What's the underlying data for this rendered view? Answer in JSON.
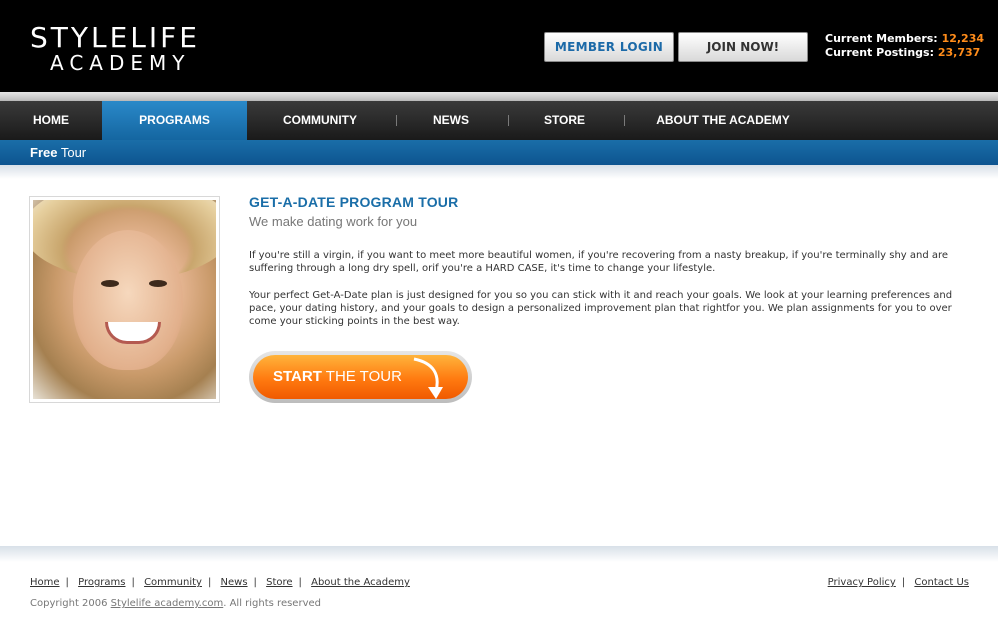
{
  "header": {
    "logo_line1": "STYLELIFE",
    "logo_line2": "ACADEMY",
    "member_login": "MEMBER  LOGIN",
    "join_now": "JOIN NOW!",
    "members_label": "Current Members:",
    "members_value": "12,234",
    "postings_label": "Current Postings:",
    "postings_value": "23,737"
  },
  "nav": {
    "items": [
      {
        "label": "HOME",
        "active": false
      },
      {
        "label": "PROGRAMS",
        "active": true
      },
      {
        "label": "COMMUNITY",
        "active": false
      },
      {
        "label": "NEWS",
        "active": false
      },
      {
        "label": "STORE",
        "active": false
      },
      {
        "label": "ABOUT THE ACADEMY",
        "active": false
      }
    ]
  },
  "subnav": {
    "bold": "Free",
    "rest": " Tour"
  },
  "content": {
    "title": "GET-A-DATE PROGRAM TOUR",
    "subtitle": "We make dating work for you",
    "para1": "If you're still a virgin, if you want to meet more beautiful women, if you're recovering from a nasty breakup, if you're terminally shy and are suffering through a long dry spell, orif you're a HARD CASE, it's time to change your lifestyle.",
    "para2": "Your perfect Get-A-Date plan is just designed for you so you can stick with it and reach your goals. We look at your learning preferences and pace, your dating history, and your goals to design a personalized improvement plan that rightfor you. We plan assignments for you to over come your sticking points in the best way.",
    "cta_bold": "START",
    "cta_rest": " THE TOUR"
  },
  "footer": {
    "links": [
      "Home",
      "Programs",
      "Community",
      "News",
      "Store",
      "About the Academy"
    ],
    "right_links": [
      "Privacy Policy",
      "Contact Us"
    ],
    "copyright_prefix": "Copyright 2006 ",
    "copyright_link": "Stylelife academy.com",
    "copyright_suffix": ".  All rights reserved"
  },
  "colors": {
    "accent_blue": "#1a6ea8",
    "accent_orange": "#ff7a10",
    "header_bg": "#000000"
  }
}
